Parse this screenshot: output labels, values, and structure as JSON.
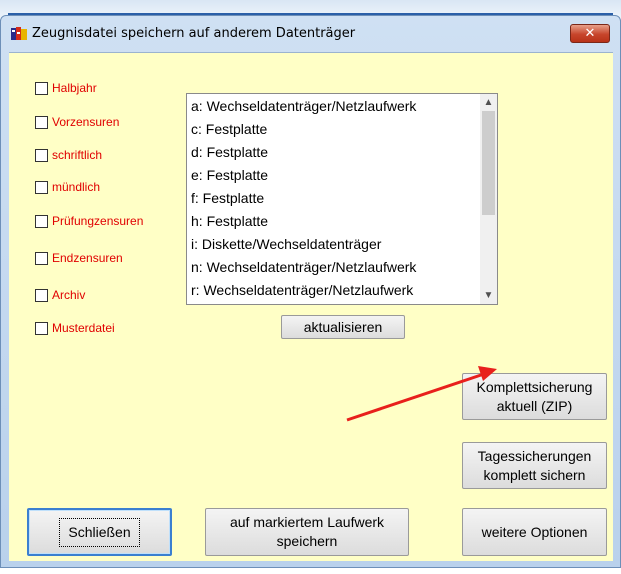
{
  "window": {
    "title": "Zeugnisdatei speichern auf anderem Datenträger",
    "close_label": "✕"
  },
  "checkboxes": [
    {
      "label": "Halbjahr",
      "checked": false
    },
    {
      "label": "Vorzensuren",
      "checked": false
    },
    {
      "label": "schriftlich",
      "checked": false
    },
    {
      "label": "mündlich",
      "checked": false
    },
    {
      "label": "Prüfungzensuren",
      "checked": false
    },
    {
      "label": "Endzensuren",
      "checked": false
    },
    {
      "label": "Archiv",
      "checked": false
    },
    {
      "label": "Musterdatei",
      "checked": false
    }
  ],
  "drives": [
    "a:  Wechseldatenträger/Netzlaufwerk",
    "c:  Festplatte",
    "d:  Festplatte",
    "e:  Festplatte",
    "f:  Festplatte",
    "h:  Festplatte",
    "i:  Diskette/Wechseldatenträger",
    "n:  Wechseldatenträger/Netzlaufwerk",
    "r:  Wechseldatenträger/Netzlaufwerk"
  ],
  "buttons": {
    "refresh": "aktualisieren",
    "full_backup_line1": "Komplettsicherung",
    "full_backup_line2": "aktuell (ZIP)",
    "daily_backup_line1": "Tagessicherungen",
    "daily_backup_line2": "komplett sichern",
    "close": "Schließen",
    "save_line1": "auf markiertem Laufwerk",
    "save_line2": "speichern",
    "more_options": "weitere Optionen"
  },
  "colors": {
    "client_background": "#ffffc6",
    "checkbox_label": "#e00000",
    "annotation_arrow": "#e8201c"
  }
}
